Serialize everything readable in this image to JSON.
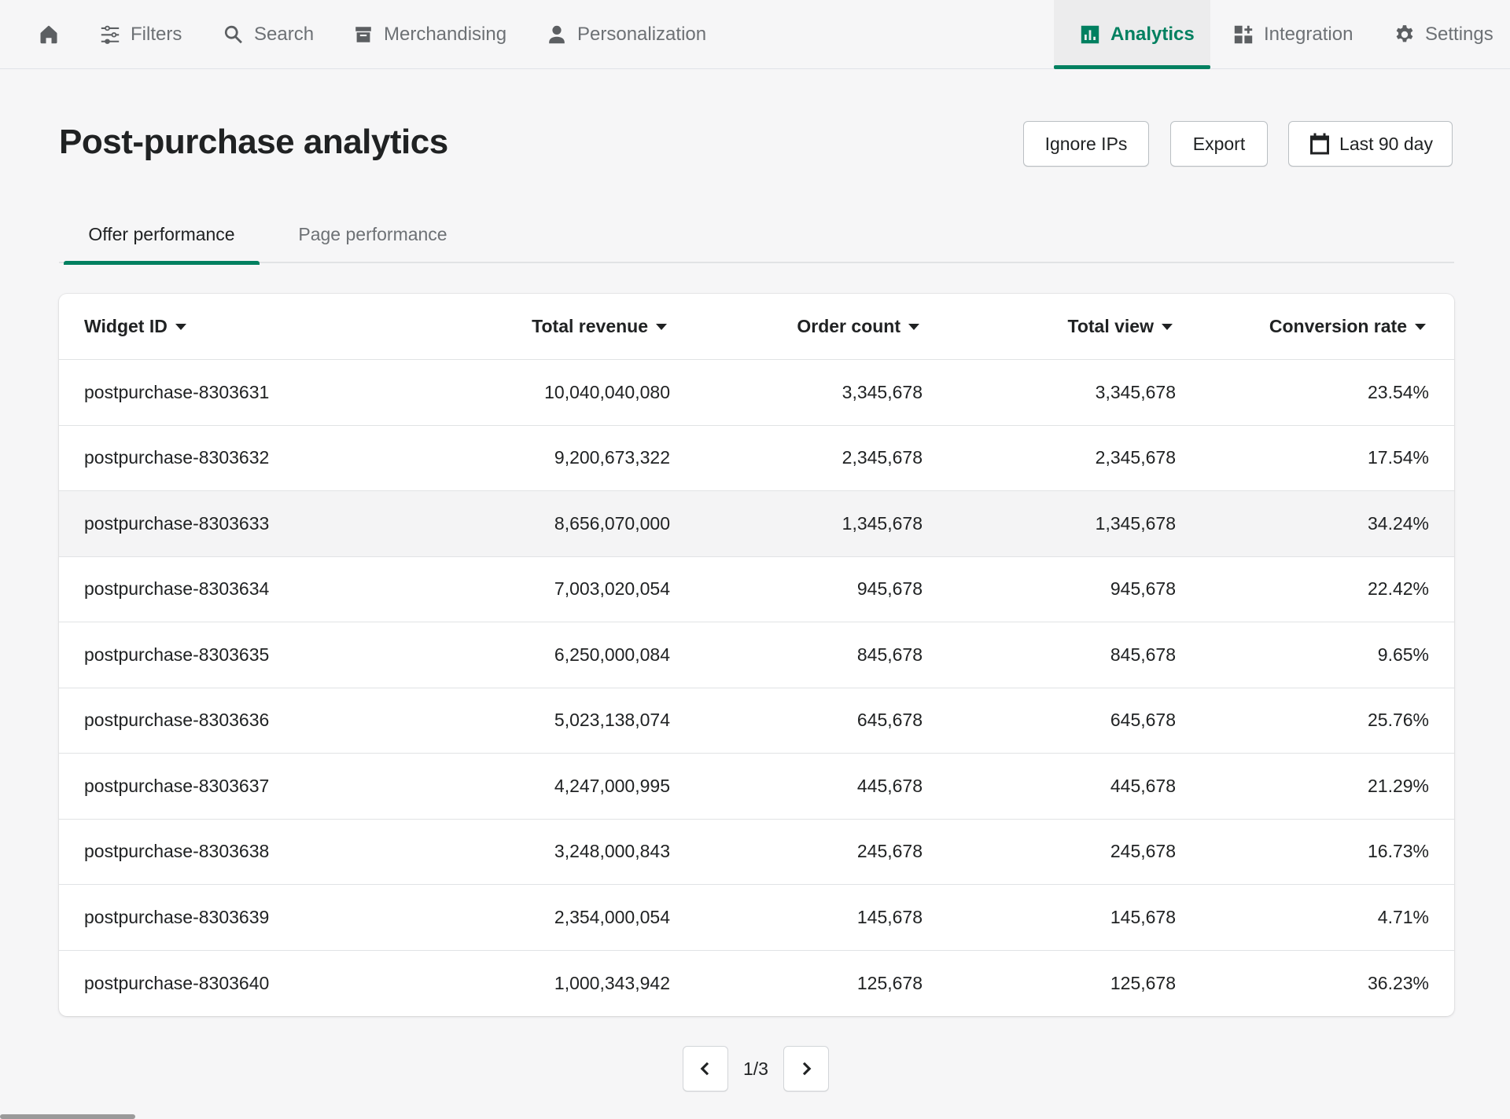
{
  "nav": {
    "items": [
      {
        "label": "",
        "icon": "home-icon"
      },
      {
        "label": "Filters",
        "icon": "sliders-icon"
      },
      {
        "label": "Search",
        "icon": "search-icon"
      },
      {
        "label": "Merchandising",
        "icon": "archive-icon"
      },
      {
        "label": "Personalization",
        "icon": "person-icon"
      },
      {
        "label": "Analytics",
        "icon": "bar-chart-icon",
        "active": true
      },
      {
        "label": "Integration",
        "icon": "apps-icon"
      },
      {
        "label": "Settings",
        "icon": "gear-icon"
      }
    ]
  },
  "header": {
    "title": "Post-purchase analytics",
    "ignore_ips_label": "Ignore IPs",
    "export_label": "Export",
    "date_range_label": "Last 90 day"
  },
  "tabs": [
    {
      "label": "Offer performance",
      "active": true
    },
    {
      "label": "Page performance",
      "active": false
    }
  ],
  "table": {
    "columns": [
      "Widget ID",
      "Total revenue",
      "Order count",
      "Total view",
      "Conversion rate"
    ],
    "rows": [
      [
        "postpurchase-8303631",
        "10,040,040,080",
        "3,345,678",
        "3,345,678",
        "23.54%"
      ],
      [
        "postpurchase-8303632",
        "9,200,673,322",
        "2,345,678",
        "2,345,678",
        "17.54%"
      ],
      [
        "postpurchase-8303633",
        "8,656,070,000",
        "1,345,678",
        "1,345,678",
        "34.24%"
      ],
      [
        "postpurchase-8303634",
        "7,003,020,054",
        "945,678",
        "945,678",
        "22.42%"
      ],
      [
        "postpurchase-8303635",
        "6,250,000,084",
        "845,678",
        "845,678",
        "9.65%"
      ],
      [
        "postpurchase-8303636",
        "5,023,138,074",
        "645,678",
        "645,678",
        "25.76%"
      ],
      [
        "postpurchase-8303637",
        "4,247,000,995",
        "445,678",
        "445,678",
        "21.29%"
      ],
      [
        "postpurchase-8303638",
        "3,248,000,843",
        "245,678",
        "245,678",
        "16.73%"
      ],
      [
        "postpurchase-8303639",
        "2,354,000,054",
        "145,678",
        "145,678",
        "4.71%"
      ],
      [
        "postpurchase-8303640",
        "1,000,343,942",
        "125,678",
        "125,678",
        "36.23%"
      ]
    ]
  },
  "pagination": {
    "label": "1/3"
  },
  "colors": {
    "accent": "#008060",
    "background": "#f6f6f7",
    "text": "#202223"
  }
}
